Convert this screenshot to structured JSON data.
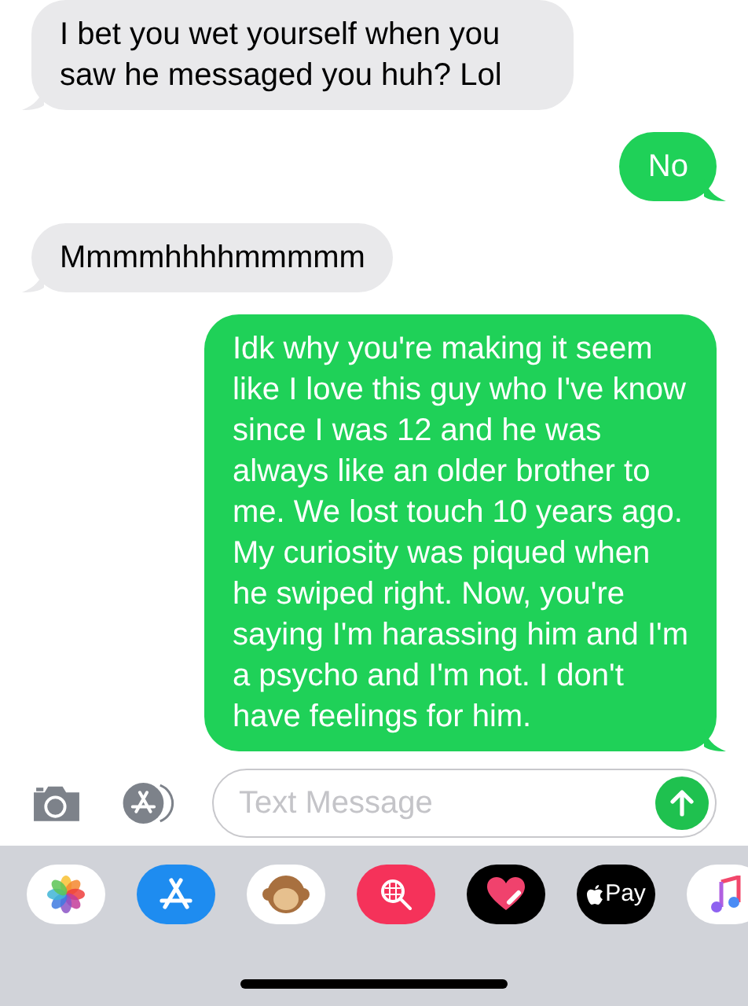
{
  "messages": [
    {
      "kind": "received",
      "text": "I bet you wet yourself when you saw he messaged you huh? Lol"
    },
    {
      "kind": "sent",
      "text": "No"
    },
    {
      "kind": "received",
      "text": "Mmmmhhhhmmmmm"
    },
    {
      "kind": "sent",
      "text": "Idk why you're making it seem like I love this guy who I've know since I was 12 and he was always like an older brother to me. We lost touch 10 years ago. My curiosity was piqued when he swiped right. Now, you're saying I'm harassing him and I'm a psycho and I'm not. I don't have feelings for him."
    }
  ],
  "composer": {
    "placeholder": "Text Message"
  },
  "app_drawer": [
    {
      "kind": "photos"
    },
    {
      "kind": "appstore"
    },
    {
      "kind": "animoji"
    },
    {
      "kind": "search"
    },
    {
      "kind": "heart"
    },
    {
      "kind": "pay",
      "label": "Pay"
    },
    {
      "kind": "music"
    }
  ]
}
